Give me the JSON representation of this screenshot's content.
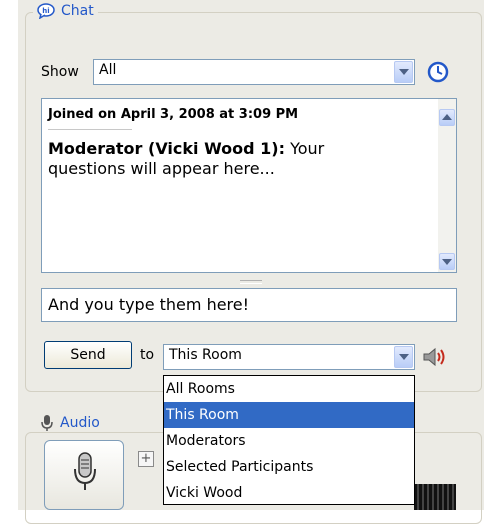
{
  "chat": {
    "title": "Chat",
    "show_label": "Show",
    "show_value": "All",
    "transcript": {
      "joined": "Joined on April 3, 2008 at 3:09 PM",
      "sender": "Moderator (Vicki Wood 1):",
      "message": " Your questions will appear here..."
    },
    "input_value": "And you type them here!",
    "send_label": "Send",
    "to_label": "to",
    "to_value": "This Room",
    "dropdown_options": [
      "All Rooms",
      "This Room",
      "Moderators",
      "Selected Participants",
      "Vicki Wood"
    ],
    "selected_option": "This Room"
  },
  "audio": {
    "title": "Audio",
    "add_label": "+"
  },
  "colors": {
    "accent": "#2358c9",
    "selection": "#316ac5",
    "panel_bg": "#ecebe5"
  },
  "icons": [
    "chat-icon",
    "clock-icon",
    "speaker-icon",
    "microphone-icon",
    "mic-small-icon"
  ]
}
